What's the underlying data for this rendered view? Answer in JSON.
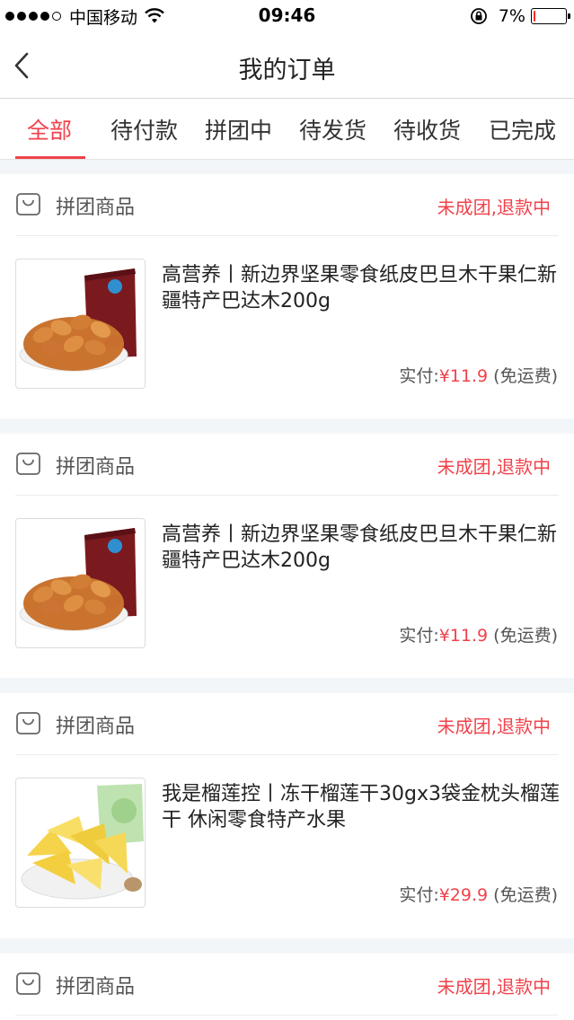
{
  "status_bar": {
    "carrier": "中国移动",
    "time": "09:46",
    "battery_percent": "7%",
    "battery_level": 0.07,
    "signal_bars": 4,
    "signal_total": 5
  },
  "nav": {
    "title": "我的订单"
  },
  "tabs": [
    {
      "label": "全部",
      "active": true
    },
    {
      "label": "待付款",
      "active": false
    },
    {
      "label": "拼团中",
      "active": false
    },
    {
      "label": "待发货",
      "active": false
    },
    {
      "label": "待收货",
      "active": false
    },
    {
      "label": "已完成",
      "active": false
    }
  ],
  "colors": {
    "accent": "#f0424b",
    "background": "#f3f6f9"
  },
  "orders": [
    {
      "group_label": "拼团商品",
      "status": "未成团,退款中",
      "title": "高营养丨新边界坚果零食纸皮巴旦木干果仁新疆特产巴达木200g",
      "price_prefix": "实付:",
      "price": "¥11.9",
      "shipping": "(免运费)",
      "image_icon": "almond-bag-image"
    },
    {
      "group_label": "拼团商品",
      "status": "未成团,退款中",
      "title": "高营养丨新边界坚果零食纸皮巴旦木干果仁新疆特产巴达木200g",
      "price_prefix": "实付:",
      "price": "¥11.9",
      "shipping": "(免运费)",
      "image_icon": "almond-bag-image"
    },
    {
      "group_label": "拼团商品",
      "status": "未成团,退款中",
      "title": "我是榴莲控丨冻干榴莲干30gx3袋金枕头榴莲干 休闲零食特产水果",
      "price_prefix": "实付:",
      "price": "¥29.9",
      "shipping": "(免运费)",
      "image_icon": "durian-chips-image"
    },
    {
      "group_label": "拼团商品",
      "status": "未成团,退款中"
    }
  ]
}
